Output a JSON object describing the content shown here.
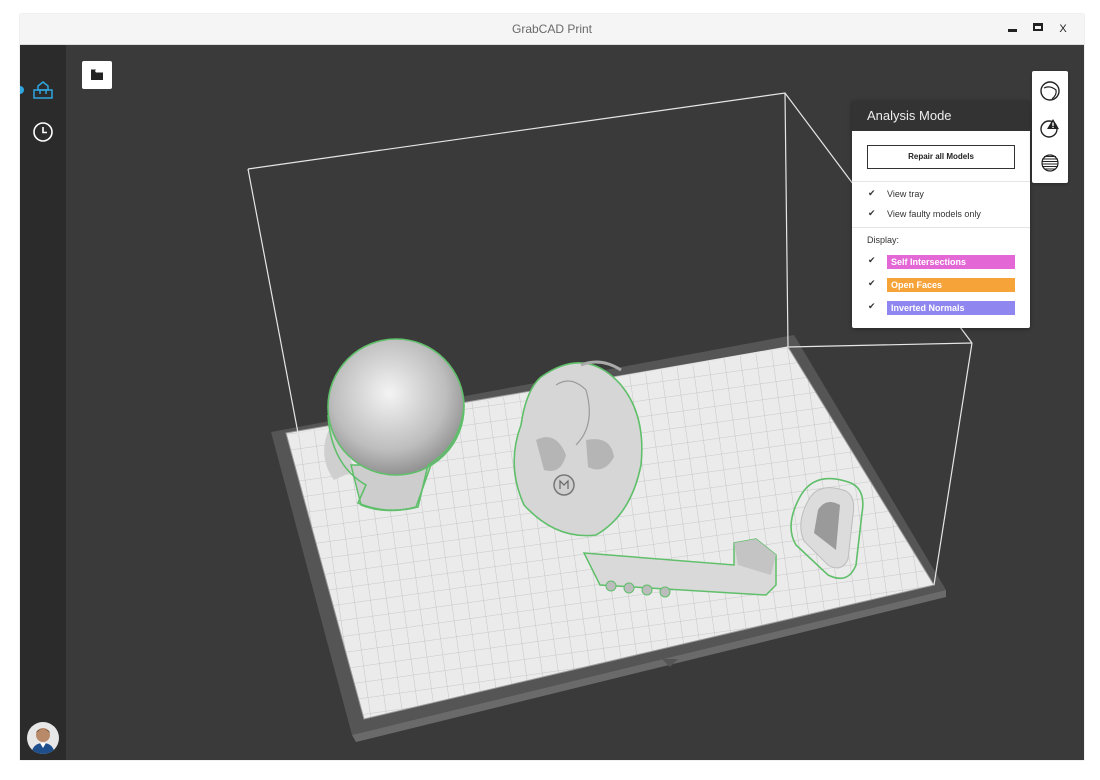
{
  "window": {
    "title": "GrabCAD Print",
    "close_label": "X"
  },
  "sidebar": {
    "items": [
      {
        "name": "models",
        "icon": "model-box-icon",
        "active": true
      },
      {
        "name": "history",
        "icon": "clock-icon",
        "active": false
      }
    ],
    "accent": "#2ea6e0"
  },
  "toolbar": {
    "open_icon": "folder-icon"
  },
  "analysis_panel": {
    "title": "Analysis Mode",
    "repair_button": "Repair all Models",
    "options": [
      {
        "label": "View tray",
        "checked": true
      },
      {
        "label": "View faulty models only",
        "checked": true
      }
    ],
    "display_label": "Display:",
    "display_items": [
      {
        "label": "Self Intersections",
        "checked": true,
        "color": "#e467d6"
      },
      {
        "label": "Open Faces",
        "checked": true,
        "color": "#f6a339"
      },
      {
        "label": "Inverted Normals",
        "checked": true,
        "color": "#8f86f0"
      }
    ]
  },
  "view_tools": [
    {
      "icon": "sphere-icon"
    },
    {
      "icon": "warning-analysis-icon"
    },
    {
      "icon": "slice-layers-icon"
    }
  ],
  "colors": {
    "viewport_bg": "#3a3a3a",
    "model_outline": "#5fbf6a",
    "tray": "#e8e8e8"
  }
}
